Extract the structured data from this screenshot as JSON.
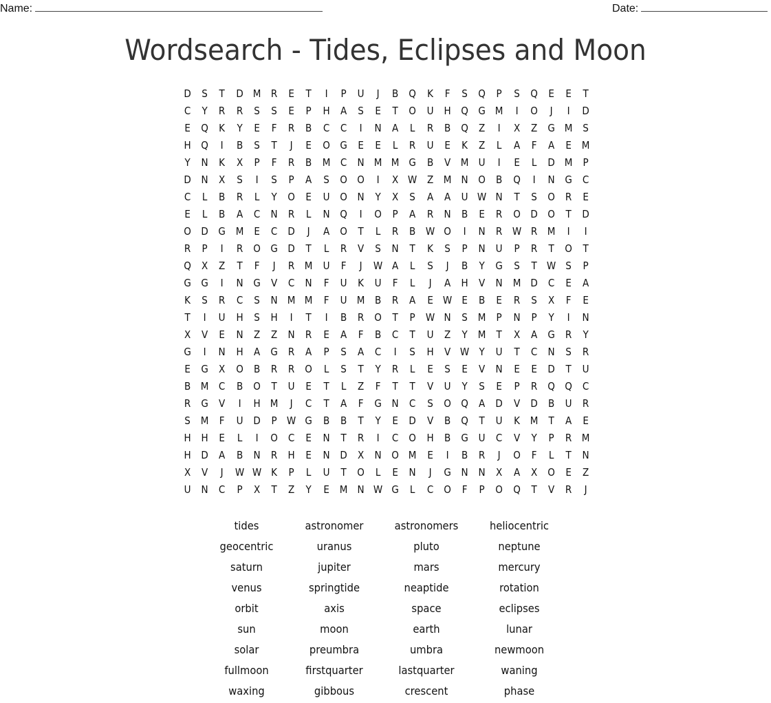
{
  "header": {
    "name_label": "Name:",
    "date_label": "Date:"
  },
  "title": "Wordsearch - Tides, Eclipses and Moon",
  "grid": [
    "DSTDMRETIPUJBQKFSQPSQEET",
    "CYRRSSEPHASETOUHQGMIOJID",
    "EQKYEFRBCCINALRBQZIXZGMS",
    "HQIBSTJEOGEELRUEKZLAFAEM",
    "YNKXPFRBMCNMMGBVMUIELDMP",
    "DNXSISPASOOIXWZMNOBQINGC",
    "CLBRLYOEUONYXSAAUWNTSORE",
    "ELBACNRLNQIOPARNBERODOTD",
    "ODGMECDJAOTLRBWOINRWRMII",
    "RPIROGDTLRVSNTKSPNUPRTOT",
    "QXZTFJRMUFJWALSJBYGSTWSP",
    "GGINGVCNFUKUFLJAHVNMDCEA",
    "KSRCSNMMFUMBRAEWEBERSXFE",
    "TIUHSHITIBROTPWNSMPNPYIN",
    "XVENZZNREAFBCTUZYMTXAGRY",
    "GINHAGRAPSACISHVWYUTCNSR",
    "EGXOBRROLSTYRLESEVNEEDTU",
    "BMCBOTUETLZFTTVUYSEPRQQC",
    "RGVIHMJCTAFGNCSOQADVDBUR",
    "SMFUDPWGBBTYEDVBQTUKMTAE",
    "HHELIOCENTRICOHBGUCVYPRM",
    "HDABNRHENDXNOMEIBRJOFLTN",
    "XVJWWKPLUTOLENJGNNXAXOEZ",
    "UNCPXTZYEMNWGLCOFPOQTVRJ"
  ],
  "words": [
    [
      "tides",
      "astronomer",
      "astronomers",
      "heliocentric"
    ],
    [
      "geocentric",
      "uranus",
      "pluto",
      "neptune"
    ],
    [
      "saturn",
      "jupiter",
      "mars",
      "mercury"
    ],
    [
      "venus",
      "springtide",
      "neaptide",
      "rotation"
    ],
    [
      "orbit",
      "axis",
      "space",
      "eclipses"
    ],
    [
      "sun",
      "moon",
      "earth",
      "lunar"
    ],
    [
      "solar",
      "preumbra",
      "umbra",
      "newmoon"
    ],
    [
      "fullmoon",
      "firstquarter",
      "lastquarter",
      "waning"
    ],
    [
      "waxing",
      "gibbous",
      "crescent",
      "phase"
    ]
  ]
}
